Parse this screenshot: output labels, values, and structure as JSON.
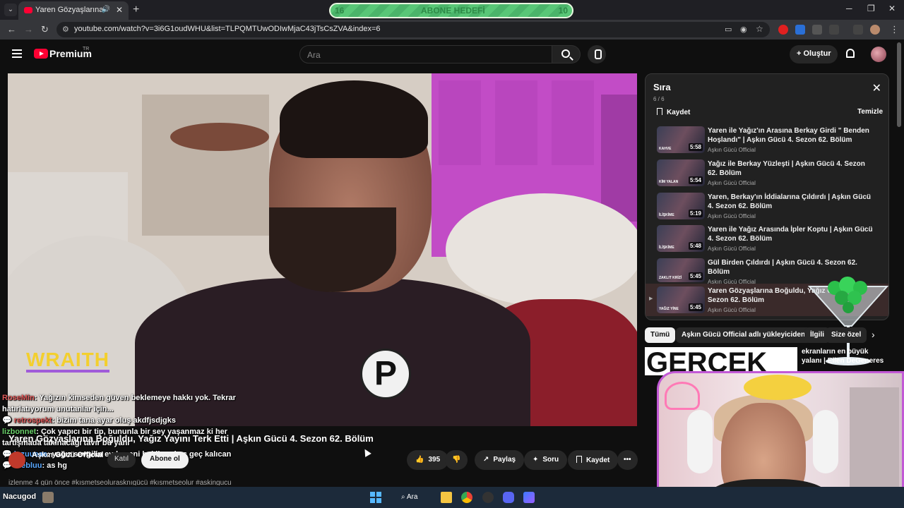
{
  "browser": {
    "tab_title": "Yaren Gözyaşlarına Boğuldu",
    "url": "youtube.com/watch?v=3i6G1oudWHU&list=TLPQMTUwODIwMjaC43jTsCsZVA&index=6",
    "audio_icon": "speaker-icon",
    "close_glyph": "✕",
    "newtab_glyph": "+"
  },
  "goal_overlay": {
    "left": "16",
    "label": "ABONE HEDEFİ",
    "right": "10",
    "colors": {
      "fill": "#59c777",
      "text": "#2e8a47"
    }
  },
  "youtube": {
    "brand": "Premium",
    "region": "TR",
    "search_placeholder": "Ara",
    "create_label": "Oluştur"
  },
  "video": {
    "overlay_brand": "WRAITH",
    "badge_letter": "P",
    "title": "Yaren Gözyaşlarına Boğuldu, Yağız Yayını Terk Etti | Aşkın Gücü 4. Sezon 62. Bölüm",
    "channel": "Aşkın Gücü Official",
    "join_label": "Katıl",
    "subscribe_label": "Abone ol",
    "likes": "395",
    "share_label": "Paylaş",
    "ask_label": "Soru",
    "save_label": "Kaydet",
    "desc_peek": "izlenme  4 gün önce  #kısmetseolurasknıgücü #kısmetseolur #askingucu"
  },
  "chat": [
    {
      "user": "RoseMin",
      "text": ": Yağızın kimseden güven beklemeye hakkı yok. Tekrar hatırlatıyorum unutanlar için..."
    },
    {
      "user": "retrospekt",
      "text": ": bizim tana ayar oluş akdfjsdjgks"
    },
    {
      "user": "lizbonnet",
      "text": ": Çok yapıcı bir tip, bununla bir sey yaşanmaz ki her tartışmada takınacağı tavır bu yani"
    },
    {
      "user": "luzuueas",
      "text": ": yağız sevgilin evde seni bekliyor keş geç kalıcan"
    },
    {
      "user": "thebluu",
      "text": ": as hg"
    }
  ],
  "queue": {
    "title": "Sıra",
    "count": "6 / 6",
    "save_label": "Kaydet",
    "clear_label": "Temizle",
    "items": [
      {
        "title": "Yaren ile Yağız'ın Arasına Berkay Girdi \" Benden Hoşlandı\" | Aşkın Gücü 4. Sezon 62. Bölüm",
        "channel": "Aşkın Gücü Official",
        "duration": "5:58",
        "tag": "KAHVE"
      },
      {
        "title": "Yağız ile Berkay Yüzleşti | Aşkın Gücü 4. Sezon 62. Bölüm",
        "channel": "Aşkın Gücü Official",
        "duration": "5:54",
        "tag": "KİM YALAN"
      },
      {
        "title": "Yaren, Berkay'ın İddialarına Çıldırdı | Aşkın Gücü 4. Sezon 62. Bölüm",
        "channel": "Aşkın Gücü Official",
        "duration": "5:19",
        "tag": "İLİŞKİME"
      },
      {
        "title": "Yaren ile Yağız Arasında İpler Koptu | Aşkın Gücü 4. Sezon 62. Bölüm",
        "channel": "Aşkın Gücü Official",
        "duration": "5:48",
        "tag": "İLİŞKİME"
      },
      {
        "title": "Gül Birden Çıldırdı | Aşkın Gücü 4. Sezon 62. Bölüm",
        "channel": "Aşkın Gücü Official",
        "duration": "5:45",
        "tag": "ZAKLIT KRİZİ"
      },
      {
        "title": "Yaren Gözyaşlarına Boğuldu, Yağız Gücü 4. Sezon 62. Bölüm",
        "channel": "Aşkın Gücü Official",
        "duration": "5:45",
        "tag": "YAĞIZ YİNE"
      }
    ]
  },
  "chips": [
    "Tümü",
    "Aşkın Gücü Official adlı yükleyiciden",
    "İlgili",
    "Size özel"
  ],
  "recommendation": {
    "thumb_text": "GERÇEK",
    "title": "ekranların en büyük yalanı | Ellen DeGeneres",
    "channel": ""
  },
  "taskbar": {
    "user": "Nacugod",
    "search_label": "Ara"
  },
  "icons": {
    "back": "arrow-left-icon",
    "search": "search-icon",
    "mic": "microphone-icon",
    "bell": "bell-icon"
  }
}
